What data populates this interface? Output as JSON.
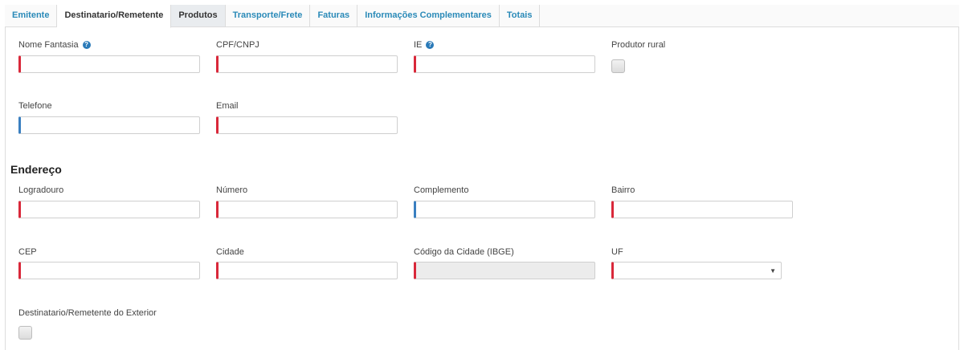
{
  "tabs": [
    {
      "label": "Emitente"
    },
    {
      "label": "Destinatario/Remetente"
    },
    {
      "label": "Produtos"
    },
    {
      "label": "Transporte/Frete"
    },
    {
      "label": "Faturas"
    },
    {
      "label": "Informações Complementares"
    },
    {
      "label": "Totais"
    }
  ],
  "fields": {
    "nome_fantasia": {
      "label": "Nome Fantasia",
      "value": ""
    },
    "cpf_cnpj": {
      "label": "CPF/CNPJ",
      "value": ""
    },
    "ie": {
      "label": "IE",
      "value": ""
    },
    "produtor_rural": {
      "label": "Produtor rural"
    },
    "telefone": {
      "label": "Telefone",
      "value": ""
    },
    "email": {
      "label": "Email",
      "value": ""
    }
  },
  "endereco": {
    "title": "Endereço",
    "logradouro": {
      "label": "Logradouro",
      "value": ""
    },
    "numero": {
      "label": "Número",
      "value": ""
    },
    "complemento": {
      "label": "Complemento",
      "value": ""
    },
    "bairro": {
      "label": "Bairro",
      "value": ""
    },
    "cep": {
      "label": "CEP",
      "value": ""
    },
    "cidade": {
      "label": "Cidade",
      "value": ""
    },
    "codigo_cidade": {
      "label": "Código da Cidade (IBGE)",
      "value": ""
    },
    "uf": {
      "label": "UF",
      "value": ""
    }
  },
  "exterior": {
    "label": "Destinatario/Remetente do Exterior"
  },
  "icons": {
    "help": "question-circle-icon",
    "dropdown": "caret-down-icon"
  },
  "colors": {
    "required": "#d9283a",
    "optional": "#3a7fc0",
    "tab_link": "#2a8ab8"
  }
}
